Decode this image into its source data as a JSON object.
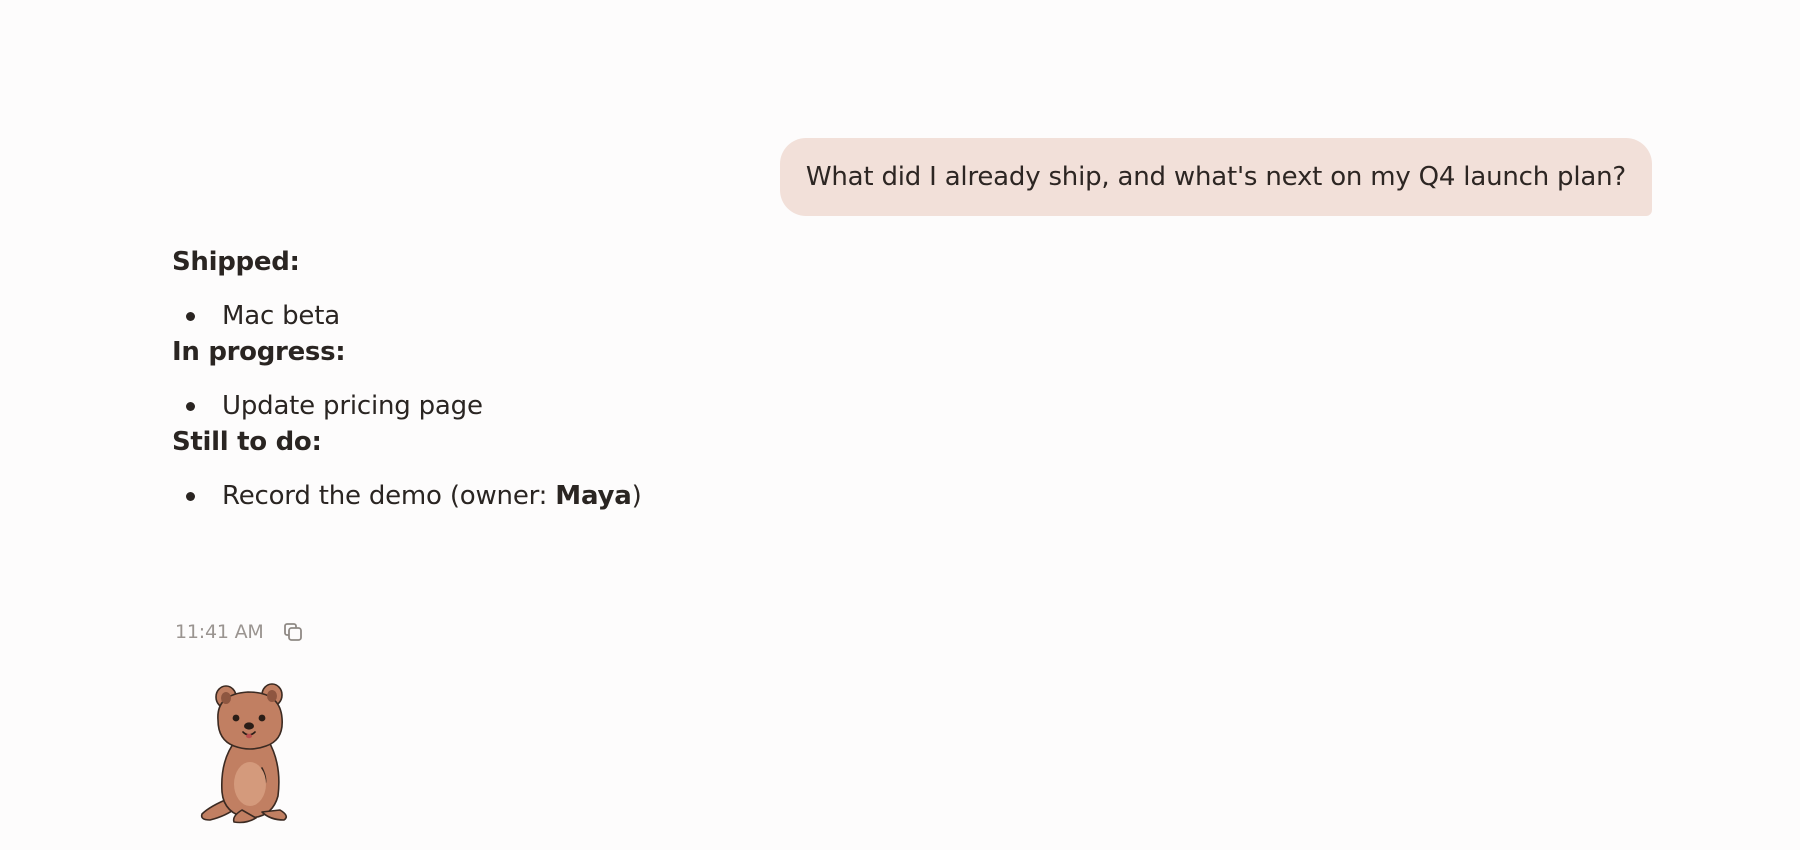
{
  "conversation": {
    "user_message": "What did I already ship, and what's next on my Q4 launch plan?",
    "assistant_reply": {
      "sections": [
        {
          "heading": "Shipped:",
          "item_text": "Mac beta",
          "item_bold": "",
          "item_suffix": ""
        },
        {
          "heading": "In progress:",
          "item_text": "Update pricing page",
          "item_bold": "",
          "item_suffix": ""
        },
        {
          "heading": "Still to do:",
          "item_text": "Record the demo (owner: ",
          "item_bold": "Maya",
          "item_suffix": ")"
        }
      ],
      "timestamp": "11:41 AM"
    }
  },
  "icons": {
    "copy": "copy-icon",
    "mascot": "quokka-mascot"
  },
  "colors": {
    "background": "#fdfcfc",
    "user_bubble": "#f2e0d9",
    "text": "#2a2522",
    "muted": "#9a9490",
    "mascot_fur": "#c17f62",
    "mascot_outline": "#3b2a22"
  }
}
